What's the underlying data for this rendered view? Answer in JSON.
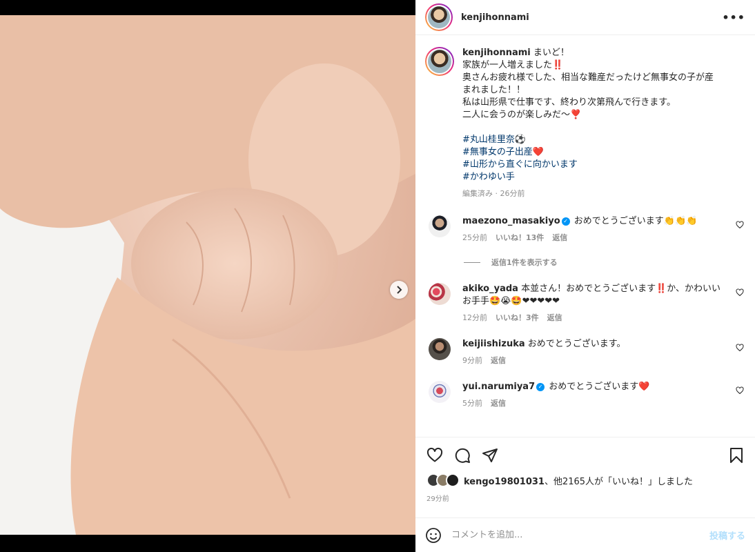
{
  "post": {
    "username": "kenjihonnami",
    "more_icon": "ellipsis-icon",
    "caption_lines": [
      "まいど！",
      "家族が一人増えました‼️",
      "奥さんお疲れ様でした、相当な難産だったけど無事女の子が産",
      "まれました！！",
      "私は山形県で仕事です、終わり次第飛んで行きます。",
      "二人に会うのが楽しみだ〜❣️"
    ],
    "hashtags": [
      "#丸山桂里奈⚽️",
      "#無事女の子出産❤️",
      "#山形から直ぐに向かいます",
      "#かわゆい手"
    ],
    "caption_meta": "編集済み · 26分前"
  },
  "comments": [
    {
      "username": "maezono_masakiyo",
      "verified": true,
      "text": "おめでとうございます👏👏👏",
      "time": "25分前",
      "likes": "いいね！13件",
      "reply": "返信",
      "avatar_color": "#2f3440"
    },
    {
      "username": "akiko_yada",
      "verified": false,
      "text": "本並さん！おめでとうございます‼️か、かわいいお手手🤩😭🤩❤❤❤❤❤",
      "time": "12分前",
      "likes": "いいね！3件",
      "reply": "返信",
      "avatar_color": "#c9445a"
    },
    {
      "username": "keijiishizuka",
      "verified": false,
      "text": "おめでとうございます。",
      "time": "9分前",
      "reply": "返信",
      "avatar_color": "#3b332b"
    },
    {
      "username": "yui.narumiya7",
      "verified": true,
      "text": "おめでとうございます❤️",
      "time": "5分前",
      "reply": "返信",
      "avatar_color": "#d64a5a"
    }
  ],
  "view_replies": "返信1件を表示する",
  "likes_line": {
    "user": "kengo19801031",
    "rest": "、他2165人が「いいね！」しました"
  },
  "posted_ago": "29分前",
  "comment_input": {
    "placeholder": "コメントを追加...",
    "post_label": "投稿する"
  },
  "carousel": {
    "count": 2,
    "active": 0
  },
  "colors": {
    "link": "#00376b",
    "muted": "#8e8e8e",
    "post_disabled": "#b2dffc",
    "verified": "#0095f6"
  }
}
